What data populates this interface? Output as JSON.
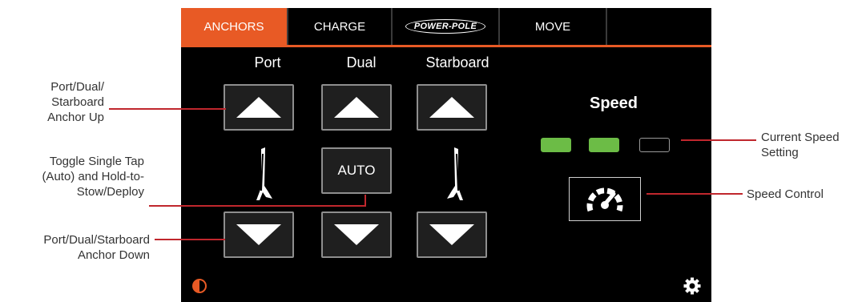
{
  "tabs": [
    {
      "label": "ANCHORS",
      "active": true
    },
    {
      "label": "CHARGE",
      "active": false
    },
    {
      "label": "POWER-POLE",
      "active": false
    },
    {
      "label": "MOVE",
      "active": false
    },
    {
      "label": "",
      "active": false
    }
  ],
  "columns": {
    "port": "Port",
    "dual": "Dual",
    "starboard": "Starboard"
  },
  "auto_label": "AUTO",
  "speed": {
    "title": "Speed",
    "level": 2,
    "max": 3
  },
  "colors": {
    "accent": "#e85a25",
    "led_on": "#6cbc46",
    "callout_line": "#c0272d"
  },
  "icons": {
    "up": "triangle-up-icon",
    "down": "triangle-down-icon",
    "speed": "speedometer-icon",
    "contrast": "contrast-icon",
    "settings": "gear-icon"
  },
  "callouts": {
    "anchor_up": [
      "Port/Dual/",
      "Starboard",
      "Anchor Up"
    ],
    "toggle": [
      "Toggle Single Tap",
      "(Auto) and Hold-to-",
      "Stow/Deploy"
    ],
    "anchor_down": [
      "Port/Dual/Starboard",
      "Anchor Down"
    ],
    "current_speed": [
      "Current Speed",
      "Setting"
    ],
    "speed_control": [
      "Speed Control"
    ]
  }
}
